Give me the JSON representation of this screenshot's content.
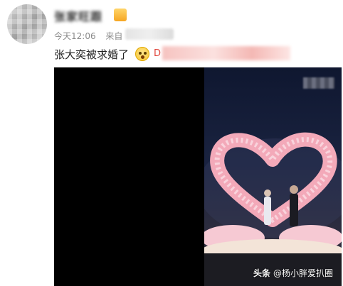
{
  "post": {
    "username": "张家旺跟",
    "time": "今天12:06",
    "source_prefix": "来自",
    "text": "张大奕被求婚了",
    "link_prefix": "D"
  },
  "media": {
    "watermark_brand": "头条",
    "watermark_handle": "@杨小胖爱扒圈"
  },
  "icons": {
    "emoji": "astonished-face-emoji",
    "badge": "vip-badge-icon"
  },
  "colors": {
    "link": "#e0463c",
    "meta": "#8a8a8a",
    "text": "#222222"
  }
}
